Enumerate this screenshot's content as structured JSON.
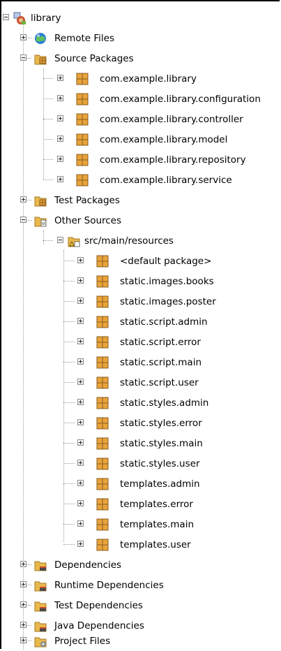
{
  "tree": {
    "root": {
      "label": "library",
      "icon": "maven-project-icon"
    },
    "nodes": [
      {
        "label": "Remote Files",
        "icon": "globe-icon"
      },
      {
        "label": "Source Packages",
        "icon": "source-packages-icon"
      },
      {
        "label": "com.example.library",
        "icon": "package-icon"
      },
      {
        "label": "com.example.library.configuration",
        "icon": "package-icon"
      },
      {
        "label": "com.example.library.controller",
        "icon": "package-icon"
      },
      {
        "label": "com.example.library.model",
        "icon": "package-icon"
      },
      {
        "label": "com.example.library.repository",
        "icon": "package-icon"
      },
      {
        "label": "com.example.library.service",
        "icon": "package-icon"
      },
      {
        "label": "Test Packages",
        "icon": "test-packages-icon"
      },
      {
        "label": "Other Sources",
        "icon": "other-sources-icon"
      },
      {
        "label": "src/main/resources",
        "icon": "resources-folder-icon"
      },
      {
        "label": "<default package>",
        "icon": "package-icon"
      },
      {
        "label": "static.images.books",
        "icon": "package-icon"
      },
      {
        "label": "static.images.poster",
        "icon": "package-icon"
      },
      {
        "label": "static.script.admin",
        "icon": "package-icon"
      },
      {
        "label": "static.script.error",
        "icon": "package-icon"
      },
      {
        "label": "static.script.main",
        "icon": "package-icon"
      },
      {
        "label": "static.script.user",
        "icon": "package-icon"
      },
      {
        "label": "static.styles.admin",
        "icon": "package-icon"
      },
      {
        "label": "static.styles.error",
        "icon": "package-icon"
      },
      {
        "label": "static.styles.main",
        "icon": "package-icon"
      },
      {
        "label": "static.styles.user",
        "icon": "package-icon"
      },
      {
        "label": "templates.admin",
        "icon": "package-icon"
      },
      {
        "label": "templates.error",
        "icon": "package-icon"
      },
      {
        "label": "templates.main",
        "icon": "package-icon"
      },
      {
        "label": "templates.user",
        "icon": "package-icon"
      },
      {
        "label": "Dependencies",
        "icon": "library-folder-icon"
      },
      {
        "label": "Runtime Dependencies",
        "icon": "library-folder-icon"
      },
      {
        "label": "Test Dependencies",
        "icon": "library-folder-icon"
      },
      {
        "label": "Java Dependencies",
        "icon": "library-folder-icon"
      },
      {
        "label": "Project Files",
        "icon": "project-files-icon"
      }
    ]
  },
  "colors": {
    "package": "#e8a33c",
    "folder": "#e9b84b",
    "globe": "#2f7fd4",
    "tree_line": "#9a9a9a"
  }
}
